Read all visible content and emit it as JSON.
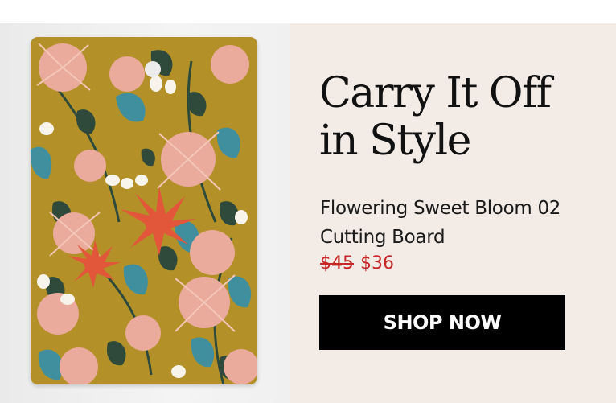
{
  "promo": {
    "headline_line1": "Carry It Off",
    "headline_line2": "in Style",
    "product_line1": "Flowering Sweet Bloom 02",
    "product_line2": "Cutting Board",
    "price_original": "$45",
    "price_sale": "$36",
    "cta_label": "SHOP NOW"
  },
  "colors": {
    "banner_bg": "#f3ebe6",
    "board_base": "#b39128",
    "price_red": "#c62828",
    "cta_bg": "#000000",
    "cta_text": "#ffffff"
  }
}
